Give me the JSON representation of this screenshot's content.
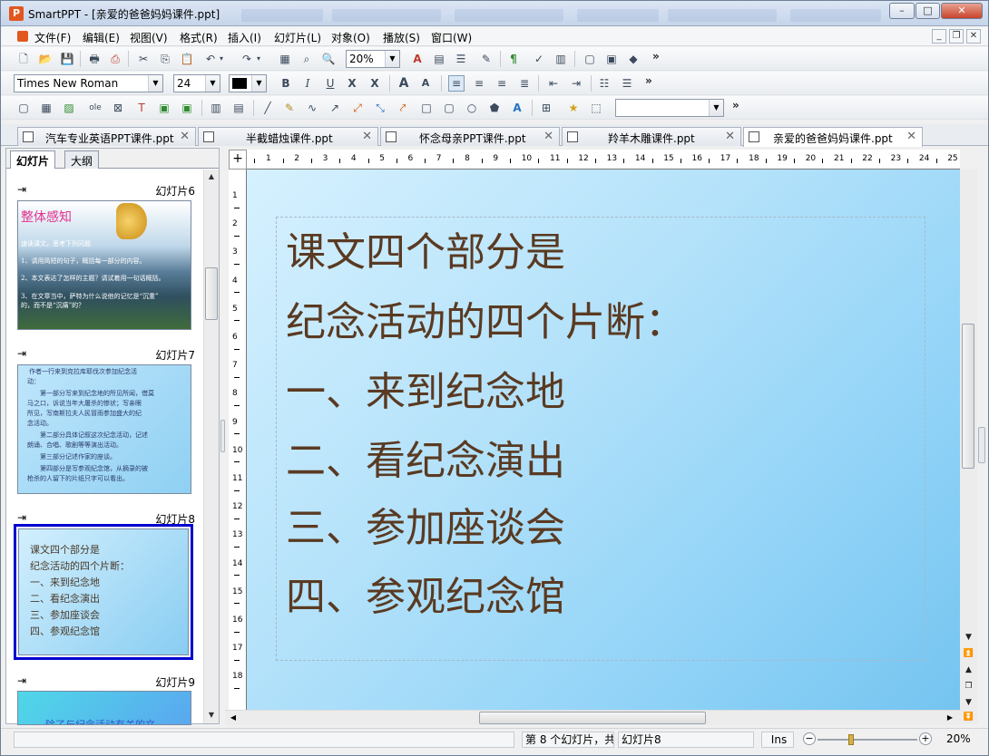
{
  "window": {
    "title": "SmartPPT - [亲爱的爸爸妈妈课件.ppt]",
    "app_icon": "P",
    "minimize": "–",
    "maximize": "□",
    "close": "✕"
  },
  "menu": {
    "items": [
      "文件(F)",
      "编辑(E)",
      "视图(V)",
      "格式(R)",
      "插入(I)",
      "幻灯片(L)",
      "对象(O)",
      "播放(S)",
      "窗口(W)"
    ],
    "mdi_minimize": "_",
    "mdi_restore": "❐",
    "mdi_close": "✕"
  },
  "toolbar1": {
    "zoom_value": "20%",
    "icons": [
      "new-icon",
      "open-icon",
      "save-icon",
      "print-icon",
      "pdf-icon",
      "cut-icon",
      "copy-icon",
      "paste-icon",
      "undo-icon",
      "redo-icon",
      "ruler-icon",
      "find-icon",
      "zoom-icon",
      "text-color-icon",
      "table-icon",
      "list-icon",
      "brush-icon",
      "paragraph-icon",
      "spell-icon",
      "chart-icon",
      "slide-icon",
      "layout-icon",
      "shape3d-icon"
    ],
    "more": "»"
  },
  "toolbar2": {
    "font_name": "Times New Roman",
    "font_size": "24",
    "text_color": "#000000",
    "bold": "B",
    "italic": "I",
    "underline": "U",
    "strike": "X",
    "sub": "X",
    "grow": "A",
    "shrink": "A",
    "more": "»"
  },
  "toolbar3": {
    "more": "»",
    "style_value": ""
  },
  "doc_tabs": [
    {
      "label": "汽车专业英语PPT课件.ppt",
      "selected": false
    },
    {
      "label": "半截蜡烛课件.ppt",
      "selected": false
    },
    {
      "label": "怀念母亲PPT课件.ppt",
      "selected": false
    },
    {
      "label": "羚羊木雕课件.ppt",
      "selected": false
    },
    {
      "label": "亲爱的爸爸妈妈课件.ppt",
      "selected": true
    }
  ],
  "tab_close": "✕",
  "side_panel": {
    "tabs": [
      "幻灯片",
      "大纲"
    ],
    "slides": [
      {
        "label": "幻灯片6"
      },
      {
        "label": "幻灯片7"
      },
      {
        "label": "幻灯片8"
      },
      {
        "label": "幻灯片9"
      }
    ],
    "arrow": "⇥",
    "slide6": {
      "title": "整体感知",
      "lines": [
        "速读课文，思考下列问题",
        "1、请用简短的句子，概括每一部分的内容。",
        "2、本文表达了怎样的主题？请试着用一句话概括。",
        "3、在文章当中，萨特为什么说他的记忆是“沉重”",
        "的，而不是“沉痛”的？"
      ]
    },
    "slide7": {
      "lines": [
        "作者一行来到克拉库耶伐次参加纪念活",
        "动：",
        "第一部分写来到纪念地的所见所闻，借莫",
        "马之口，诉说当年大屠杀的惨状；写亲眼",
        "所见，写南斯拉夫人民冒雨参加盛大的纪",
        "念活动。",
        "第二部分具体记叙这次纪念活动，记述",
        "朗诵、合唱、歌剧等等演出活动。",
        "第三部分记述作家的座谈。",
        "第四部分是写参观纪念馆，从摘录的被",
        "枪杀的人留下的片纸只字可以看出。"
      ]
    },
    "slide9": {
      "line": "除了与纪念活动有关的文"
    }
  },
  "slide": {
    "lines": [
      "课文四个部分是",
      "纪念活动的四个片断：",
      "一、来到纪念地",
      "二、看纪念演出",
      "三、参加座谈会",
      "四、参观纪念馆"
    ]
  },
  "ruler": {
    "h_numbers": [
      "1",
      "2",
      "3",
      "4",
      "5",
      "6",
      "7",
      "8",
      "9",
      "10",
      "11",
      "12",
      "13",
      "14",
      "15",
      "16",
      "17",
      "18",
      "19",
      "20",
      "21",
      "22",
      "23",
      "24",
      "25"
    ],
    "v_numbers": [
      "1",
      "2",
      "3",
      "4",
      "5",
      "6",
      "7",
      "8",
      "9",
      "10",
      "11",
      "12",
      "13",
      "14",
      "15",
      "16",
      "17",
      "18"
    ],
    "corner": "+"
  },
  "status": {
    "slide_count": "第 8 个幻灯片，共",
    "slide_name": "幻灯片8",
    "mode": "Ins",
    "zoom": "20%",
    "zoom_minus": "−",
    "zoom_plus": "+"
  },
  "colors": {
    "slide_text": "#5a3a22",
    "selection_border": "#0000d0",
    "slide6_title": "#e0338f"
  }
}
